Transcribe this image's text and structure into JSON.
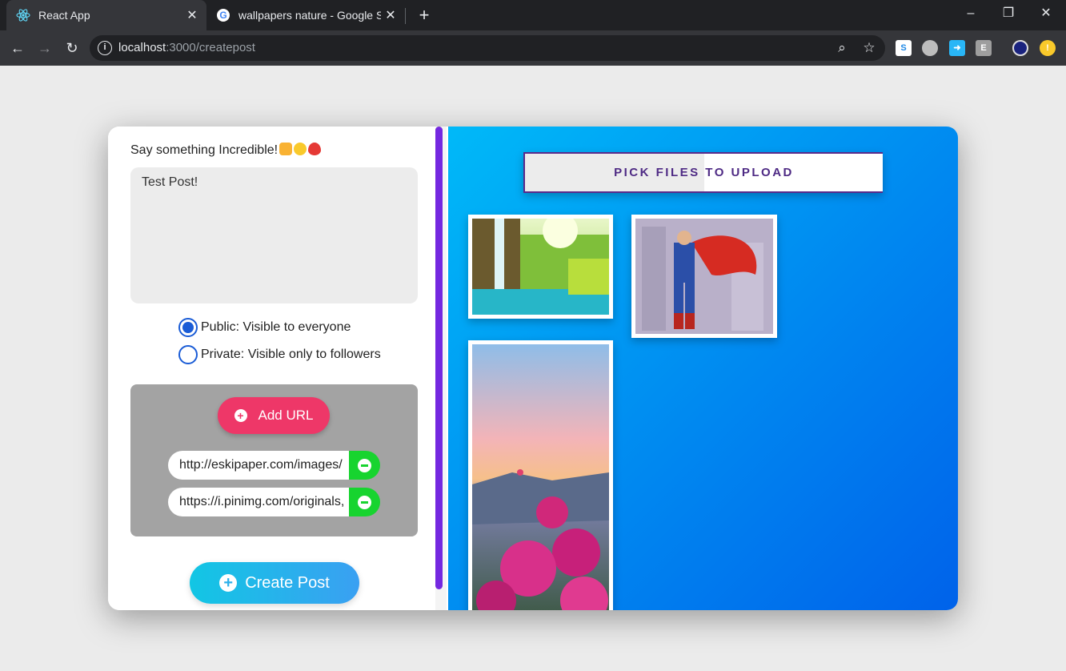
{
  "browser": {
    "tabs": [
      {
        "title": "React App",
        "active": true
      },
      {
        "title": "wallpapers nature - Google Searc",
        "active": false
      }
    ],
    "url_host": "localhost",
    "url_path": ":3000/createpost",
    "extensions": [
      "S",
      "E"
    ]
  },
  "form": {
    "prompt": "Say something Incredible!",
    "post_text": "Test Post!",
    "visibility_options": [
      {
        "label": "Public: Visible to everyone",
        "checked": true
      },
      {
        "label": "Private: Visible only to followers",
        "checked": false
      }
    ],
    "add_url_label": "Add URL",
    "urls": [
      "http://eskipaper.com/images/",
      "https://i.pinimg.com/originals,"
    ],
    "create_label": "Create Post"
  },
  "uploader": {
    "pick_label": "PICK FILES TO UPLOAD",
    "progress": 0.5,
    "images": [
      "waterfall-image",
      "superman-image",
      "bougainvillea-sunset-image"
    ]
  },
  "colors": {
    "accent_pink": "#ee3768",
    "accent_green": "#17d42f",
    "accent_purple": "#4e2a84",
    "radio_blue": "#1a5cd6"
  }
}
